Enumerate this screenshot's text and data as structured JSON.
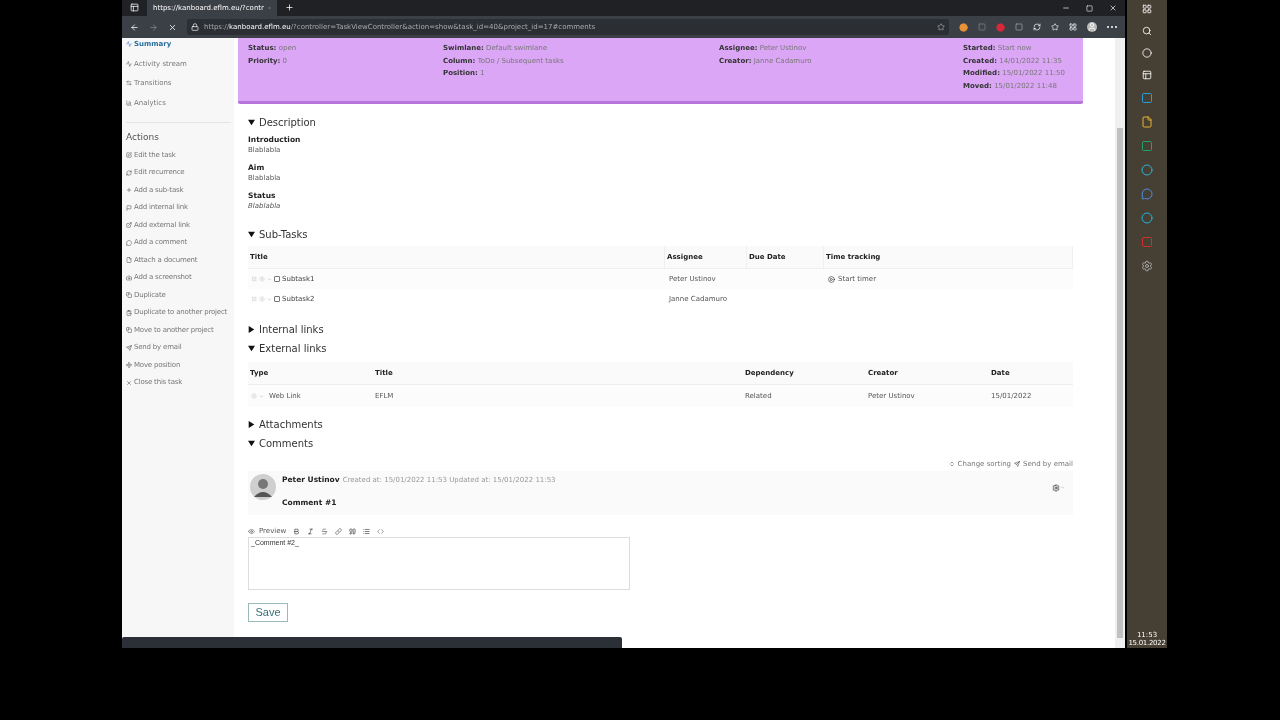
{
  "browser": {
    "tab_title": "https://kanboard.eflm.eu/?contr",
    "url_host": "kanboard.eflm.eu",
    "url_prefix": "https://",
    "url_rest": "/?controller=TaskViewController&action=show&task_id=40&project_id=17#comments"
  },
  "sidebar": {
    "items": [
      {
        "label": "Summary",
        "selected": true
      },
      {
        "label": "Activity stream",
        "selected": false
      },
      {
        "label": "Transitions",
        "selected": false
      },
      {
        "label": "Analytics",
        "selected": false
      }
    ],
    "actions_title": "Actions",
    "actions": [
      "Edit the task",
      "Edit recurrence",
      "Add a sub-task",
      "Add internal link",
      "Add external link",
      "Add a comment",
      "Attach a document",
      "Add a screenshot",
      "Duplicate",
      "Duplicate to another project",
      "Move to another project",
      "Send by email",
      "Move position",
      "Close this task"
    ]
  },
  "summary": {
    "columns": [
      [
        {
          "label": "Status:",
          "value": "open"
        },
        {
          "label": "Priority:",
          "value": "0"
        }
      ],
      [
        {
          "label": "Swimlane:",
          "value": "Default swimlane"
        },
        {
          "label": "Column:",
          "value": "ToDo / Subsequent tasks"
        },
        {
          "label": "Position:",
          "value": "1"
        }
      ],
      [
        {
          "label": "Assignee:",
          "value": "Peter Ustinov"
        },
        {
          "label": "Creator:",
          "value": "Janne Cadamuro"
        }
      ],
      [
        {
          "label": "Started:",
          "value": "Start now"
        },
        {
          "label": "Created:",
          "value": "14/01/2022 11:35"
        },
        {
          "label": "Modified:",
          "value": "15/01/2022 11:50"
        },
        {
          "label": "Moved:",
          "value": "15/01/2022 11:48"
        }
      ]
    ]
  },
  "description": {
    "title": "Description",
    "expanded": true,
    "fields": [
      {
        "label": "Introduction",
        "value": "Blablabla",
        "italic": false
      },
      {
        "label": "Aim",
        "value": "Blablabla",
        "italic": false
      },
      {
        "label": "Status",
        "value": "Blablabla",
        "italic": true
      }
    ]
  },
  "subtasks": {
    "title": "Sub-Tasks",
    "expanded": true,
    "columns": [
      "Title",
      "Assignee",
      "Due Date",
      "Time tracking"
    ],
    "rows": [
      {
        "title": "Subtask1",
        "checked": false,
        "assignee": "Peter Ustinov",
        "timer": "Start timer"
      },
      {
        "title": "Subtask2",
        "checked": false,
        "assignee": "Janne Cadamuro"
      }
    ]
  },
  "internal_links": {
    "title": "Internal links",
    "expanded": false
  },
  "external_links": {
    "title": "External links",
    "expanded": true,
    "columns": [
      "Type",
      "Title",
      "Dependency",
      "Creator",
      "Date"
    ],
    "rows": [
      {
        "type": "Web Link",
        "title": "EFLM",
        "dependency": "Related",
        "creator": "Peter Ustinov",
        "date": "15/01/2022"
      }
    ]
  },
  "attachments": {
    "title": "Attachments",
    "expanded": false
  },
  "comments": {
    "title": "Comments",
    "expanded": true,
    "change_sorting": "Change sorting",
    "send_by_email": "Send by email",
    "items": [
      {
        "author": "Peter Ustinov",
        "meta": "Created at: 15/01/2022 11:53 Updated at: 15/01/2022 11:53",
        "text": "Comment #1"
      }
    ],
    "editor": {
      "preview": "Preview",
      "value": "_Comment #2_"
    },
    "save": "Save"
  },
  "taskbar": {
    "time": "11:53",
    "date": "15.01.2022"
  }
}
